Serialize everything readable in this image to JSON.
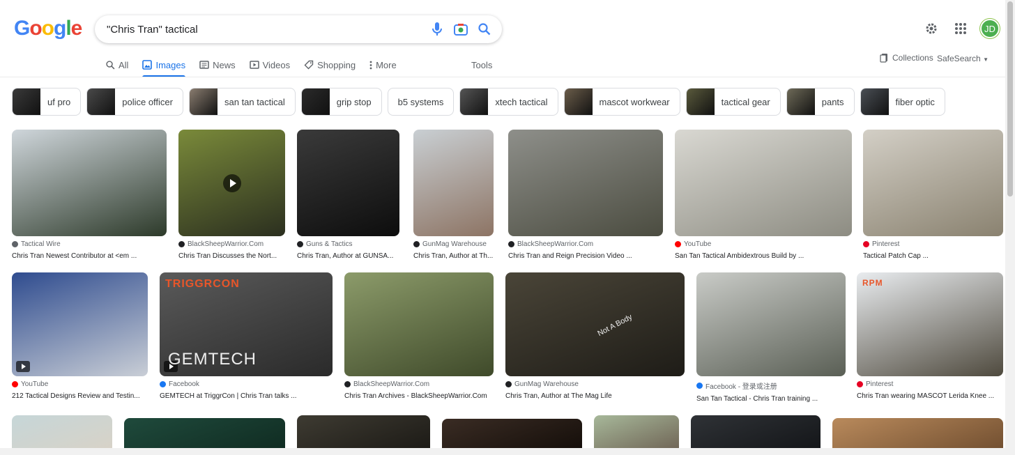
{
  "logo": {
    "letters": [
      "G",
      "o",
      "o",
      "g",
      "l",
      "e"
    ]
  },
  "search": {
    "query": "\"Chris Tran\" tactical"
  },
  "user": {
    "initials": "JD"
  },
  "tabs": [
    {
      "label": "All",
      "icon": "search-icon"
    },
    {
      "label": "Images",
      "icon": "image-icon",
      "active": true
    },
    {
      "label": "News",
      "icon": "news-icon"
    },
    {
      "label": "Videos",
      "icon": "video-icon"
    },
    {
      "label": "Shopping",
      "icon": "tag-icon"
    },
    {
      "label": "More",
      "icon": "more-vert-icon"
    }
  ],
  "tools_label": "Tools",
  "collections_label": "Collections",
  "safesearch_label": "SafeSearch",
  "chips": [
    {
      "label": "uf pro",
      "thumb": "#3a3a3a"
    },
    {
      "label": "police officer",
      "thumb": "#4a4a4a"
    },
    {
      "label": "san tan tactical",
      "thumb": "#8a7d70"
    },
    {
      "label": "grip stop",
      "thumb": "#2b2b2b"
    },
    {
      "label": "b5 systems",
      "thumb": null
    },
    {
      "label": "xtech tactical",
      "thumb": "#555"
    },
    {
      "label": "mascot workwear",
      "thumb": "#6b5d4a"
    },
    {
      "label": "tactical gear",
      "thumb": "#5a5a3c"
    },
    {
      "label": "pants",
      "thumb": "#6e6a58"
    },
    {
      "label": "fiber optic",
      "thumb": "#4a4f55"
    }
  ],
  "results": [
    {
      "source": "Tactical Wire",
      "caption": "Chris Tran Newest Contributor at <em ...",
      "icon_color": "#5f6368",
      "colors": [
        "#cfd6db",
        "#2d3a2a"
      ]
    },
    {
      "source": "BlackSheepWarrior.Com",
      "caption": "Chris Tran Discusses the Nort...",
      "icon_color": "#202124",
      "colors": [
        "#7a8a3a",
        "#2b2f1f"
      ],
      "video": true
    },
    {
      "source": "Guns & Tactics",
      "caption": "Chris Tran, Author at GUNSA...",
      "icon_color": "#202124",
      "colors": [
        "#3a3a3a",
        "#0d0d0d"
      ]
    },
    {
      "source": "GunMag Warehouse",
      "caption": "Chris Tran, Author at Th...",
      "icon_color": "#202124",
      "colors": [
        "#c9cfd3",
        "#8d7464"
      ]
    },
    {
      "source": "BlackSheepWarrior.Com",
      "caption": "Chris Tran and Reign Precision Video ...",
      "icon_color": "#202124",
      "colors": [
        "#8e8f8a",
        "#4b4c40"
      ]
    },
    {
      "source": "YouTube",
      "caption": "San Tan Tactical Ambidextrous Build by ...",
      "icon_color": "#ff0000",
      "colors": [
        "#d9d8d2",
        "#8d8c82"
      ]
    },
    {
      "source": "Pinterest",
      "caption": "Tactical Patch Cap ...",
      "icon_color": "#e60023",
      "colors": [
        "#d3cfc6",
        "#8a8270"
      ]
    },
    {
      "source": "YouTube",
      "caption": "212 Tactical Designs Review and Testin...",
      "icon_color": "#ff0000",
      "colors": [
        "#2f4c8f",
        "#c9ced6"
      ],
      "badge": true
    },
    {
      "source": "Facebook",
      "caption": "GEMTECH at TriggrCon | Chris Tran talks ...",
      "icon_color": "#1877f2",
      "colors": [
        "#5a5a5a",
        "#2a2a2a"
      ],
      "badge": true,
      "overlay_text": "GEMTECH",
      "brand_text": "TRIGGRCON"
    },
    {
      "source": "BlackSheepWarrior.Com",
      "caption": "Chris Tran Archives - BlackSheepWarrior.Com",
      "icon_color": "#202124",
      "colors": [
        "#8c9b6a",
        "#3f4a2a"
      ]
    },
    {
      "source": "GunMag Warehouse",
      "caption": "Chris Tran, Author at The Mag Life",
      "icon_color": "#202124",
      "colors": [
        "#4a4538",
        "#1e1c17"
      ],
      "overlay_text": "Not A Body"
    },
    {
      "source": "Facebook - 登录或注册",
      "caption": "San Tan Tactical - Chris Tran training ...",
      "icon_color": "#1877f2",
      "colors": [
        "#c9cbc7",
        "#5a5f55"
      ]
    },
    {
      "source": "Pinterest",
      "caption": "Chris Tran wearing MASCOT Lerida Knee ...",
      "icon_color": "#e60023",
      "colors": [
        "#e9ecef",
        "#4f4a3e"
      ],
      "brand_text": "RPM"
    }
  ],
  "partial_row": [
    {
      "colors": [
        "#c6d6d8",
        "#d9d2c6"
      ]
    },
    {
      "colors": [
        "#1f4a3c",
        "#0f2a20"
      ]
    },
    {
      "colors": [
        "#3e3b32",
        "#1a1814"
      ]
    },
    {
      "colors": [
        "#3a2c24",
        "#120c08"
      ]
    },
    {
      "colors": [
        "#a7b89a",
        "#6b5e50"
      ]
    },
    {
      "colors": [
        "#2f3236",
        "#121417"
      ]
    },
    {
      "colors": [
        "#b98a5c",
        "#6e4c2e"
      ]
    }
  ]
}
